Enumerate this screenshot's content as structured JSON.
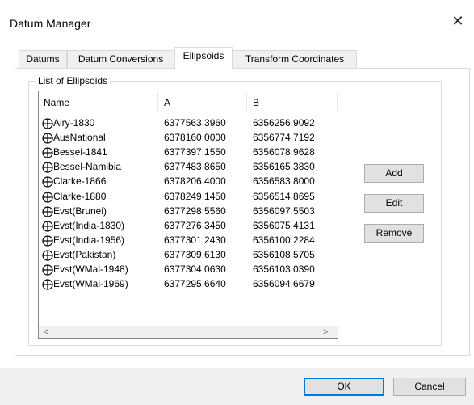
{
  "window": {
    "title": "Datum Manager",
    "close_glyph": "✕"
  },
  "tabs": [
    {
      "label": "Datums",
      "active": false
    },
    {
      "label": "Datum Conversions",
      "active": false
    },
    {
      "label": "Ellipsoids",
      "active": true
    },
    {
      "label": "Transform Coordinates",
      "active": false
    }
  ],
  "group": {
    "label": "List of Ellipsoids"
  },
  "list": {
    "columns": [
      "Name",
      "A",
      "B"
    ],
    "row_icon": "globe-icon",
    "rows": [
      {
        "name": "Airy-1830",
        "a": "6377563.3960",
        "b": "6356256.9092"
      },
      {
        "name": "AusNational",
        "a": "6378160.0000",
        "b": "6356774.7192"
      },
      {
        "name": "Bessel-1841",
        "a": "6377397.1550",
        "b": "6356078.9628"
      },
      {
        "name": "Bessel-Namibia",
        "a": "6377483.8650",
        "b": "6356165.3830"
      },
      {
        "name": "Clarke-1866",
        "a": "6378206.4000",
        "b": "6356583.8000"
      },
      {
        "name": "Clarke-1880",
        "a": "6378249.1450",
        "b": "6356514.8695"
      },
      {
        "name": "Evst(Brunei)",
        "a": "6377298.5560",
        "b": "6356097.5503"
      },
      {
        "name": "Evst(India-1830)",
        "a": "6377276.3450",
        "b": "6356075.4131"
      },
      {
        "name": "Evst(India-1956)",
        "a": "6377301.2430",
        "b": "6356100.2284"
      },
      {
        "name": "Evst(Pakistan)",
        "a": "6377309.6130",
        "b": "6356108.5705"
      },
      {
        "name": "Evst(WMal-1948)",
        "a": "6377304.0630",
        "b": "6356103.0390"
      },
      {
        "name": "Evst(WMal-1969)",
        "a": "6377295.6640",
        "b": "6356094.6679"
      }
    ]
  },
  "side_buttons": {
    "add": "Add",
    "edit": "Edit",
    "remove": "Remove"
  },
  "footer_buttons": {
    "ok": "OK",
    "cancel": "Cancel"
  },
  "scroll_glyphs": {
    "up": "^",
    "down": "v",
    "left": "<",
    "right": ">"
  }
}
